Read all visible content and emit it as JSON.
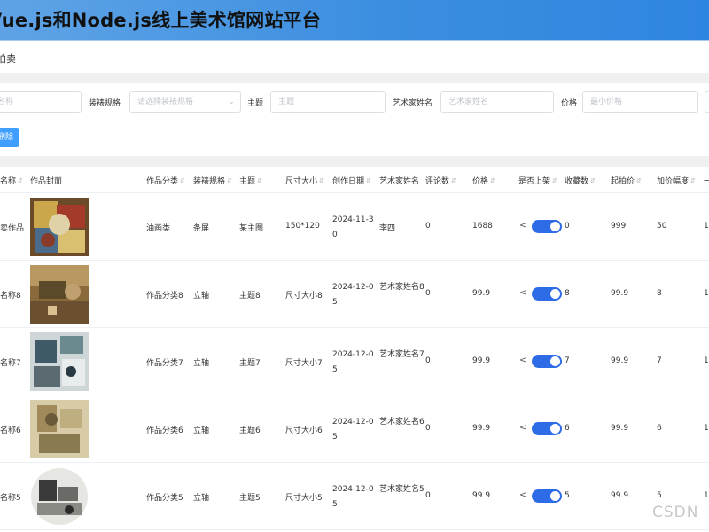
{
  "app": {
    "title": "Vue.js和Node.js线上美术馆网站平台"
  },
  "breadcrumb": "拍卖",
  "filters": {
    "name_placeholder": "名称",
    "mount_label": "装裱规格",
    "mount_placeholder": "请选择装裱规格",
    "theme_label": "主题",
    "theme_placeholder": "主题",
    "artist_label": "艺术家姓名",
    "artist_placeholder": "艺术家姓名",
    "price_label": "价格",
    "price_min_placeholder": "最小价格"
  },
  "toolbar": {
    "delete_label": "删除"
  },
  "table": {
    "headers": [
      "名称",
      "作品封面",
      "作品分类",
      "装裱规格",
      "主题",
      "尺寸大小",
      "创作日期",
      "艺术家姓名",
      "评论数",
      "价格",
      "是否上架",
      "收藏数",
      "起拍价",
      "加价幅度",
      "一"
    ],
    "rows": [
      {
        "name": "卖作品",
        "category": "油画类",
        "mount": "条屏",
        "theme": "某主图",
        "size": "150*120",
        "date": "2024-11-30",
        "artist": "李四",
        "comments": "0",
        "price": "1688",
        "listed": true,
        "favorites": "0",
        "start_price": "999",
        "increment": "50",
        "extra": "1"
      },
      {
        "name": "名称8",
        "category": "作品分类8",
        "mount": "立轴",
        "theme": "主题8",
        "size": "尺寸大小8",
        "date": "2024-12-05",
        "artist": "艺术家姓名8",
        "comments": "0",
        "price": "99.9",
        "listed": true,
        "favorites": "8",
        "start_price": "99.9",
        "increment": "8",
        "extra": "1"
      },
      {
        "name": "名称7",
        "category": "作品分类7",
        "mount": "立轴",
        "theme": "主题7",
        "size": "尺寸大小7",
        "date": "2024-12-05",
        "artist": "艺术家姓名7",
        "comments": "0",
        "price": "99.9",
        "listed": true,
        "favorites": "7",
        "start_price": "99.9",
        "increment": "7",
        "extra": "1"
      },
      {
        "name": "名称6",
        "category": "作品分类6",
        "mount": "立轴",
        "theme": "主题6",
        "size": "尺寸大小6",
        "date": "2024-12-05",
        "artist": "艺术家姓名6",
        "comments": "0",
        "price": "99.9",
        "listed": true,
        "favorites": "6",
        "start_price": "99.9",
        "increment": "6",
        "extra": "1"
      },
      {
        "name": "名称5",
        "category": "作品分类5",
        "mount": "立轴",
        "theme": "主题5",
        "size": "尺寸大小5",
        "date": "2024-12-05",
        "artist": "艺术家姓名5",
        "comments": "0",
        "price": "99.9",
        "listed": true,
        "favorites": "5",
        "start_price": "99.9",
        "increment": "5",
        "extra": "1"
      }
    ]
  },
  "watermark": "CSDN",
  "colors": {
    "header_blue": "#3b8ee0",
    "primary": "#409eff",
    "switch_on": "#2e6be6"
  }
}
